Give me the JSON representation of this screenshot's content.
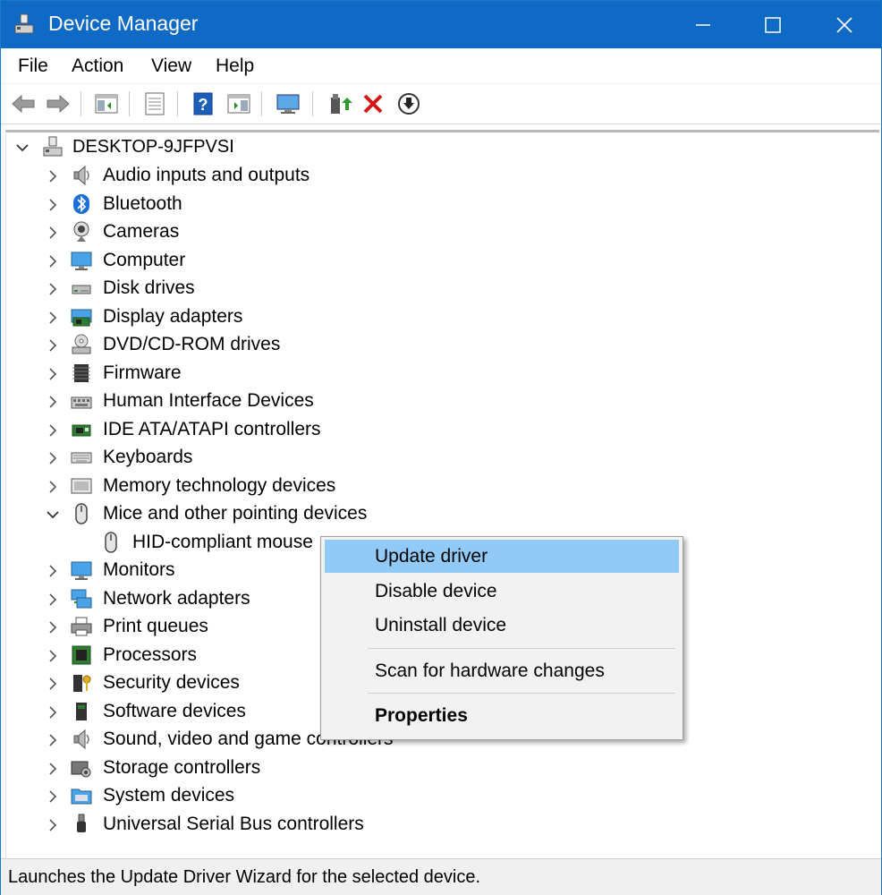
{
  "window": {
    "title": "Device Manager",
    "accent": "#0f6ac5"
  },
  "menu": {
    "items": [
      "File",
      "Action",
      "View",
      "Help"
    ]
  },
  "toolbar": {
    "buttons": [
      "back-icon",
      "forward-icon",
      "show-hide-console-tree-icon",
      "properties-icon",
      "help-icon",
      "action-pane-icon",
      "scan-hardware-monitor-icon",
      "update-driver-icon",
      "uninstall-icon",
      "download-icon"
    ]
  },
  "tree": {
    "root": "DESKTOP-9JFPVSI",
    "categories": [
      {
        "label": "Audio inputs and outputs",
        "icon": "speaker-icon"
      },
      {
        "label": "Bluetooth",
        "icon": "bluetooth-icon"
      },
      {
        "label": "Cameras",
        "icon": "camera-icon"
      },
      {
        "label": "Computer",
        "icon": "monitor-icon"
      },
      {
        "label": "Disk drives",
        "icon": "disk-drive-icon"
      },
      {
        "label": "Display adapters",
        "icon": "display-adapter-icon"
      },
      {
        "label": "DVD/CD-ROM drives",
        "icon": "dvd-drive-icon"
      },
      {
        "label": "Firmware",
        "icon": "firmware-chip-icon"
      },
      {
        "label": "Human Interface Devices",
        "icon": "hid-icon"
      },
      {
        "label": "IDE ATA/ATAPI controllers",
        "icon": "ide-controller-icon"
      },
      {
        "label": "Keyboards",
        "icon": "keyboard-icon"
      },
      {
        "label": "Memory technology devices",
        "icon": "memory-icon"
      },
      {
        "label": "Mice and other pointing devices",
        "icon": "mouse-icon",
        "expanded": true
      },
      {
        "label": "HID-compliant mouse",
        "icon": "mouse-icon",
        "child": true
      },
      {
        "label": "Monitors",
        "icon": "monitor-icon"
      },
      {
        "label": "Network adapters",
        "icon": "network-adapter-icon"
      },
      {
        "label": "Print queues",
        "icon": "printer-icon"
      },
      {
        "label": "Processors",
        "icon": "processor-icon"
      },
      {
        "label": "Security devices",
        "icon": "security-device-icon"
      },
      {
        "label": "Software devices",
        "icon": "software-device-icon"
      },
      {
        "label": "Sound, video and game controllers",
        "icon": "speaker-icon"
      },
      {
        "label": "Storage controllers",
        "icon": "storage-controller-icon"
      },
      {
        "label": "System devices",
        "icon": "system-folder-icon"
      },
      {
        "label": "Universal Serial Bus controllers",
        "icon": "usb-icon"
      }
    ]
  },
  "context_menu": {
    "update": "Update driver",
    "disable": "Disable device",
    "uninstall": "Uninstall device",
    "scan": "Scan for hardware changes",
    "properties": "Properties",
    "highlight_color": "#91c9f7"
  },
  "status": {
    "text": "Launches the Update Driver Wizard for the selected device."
  }
}
